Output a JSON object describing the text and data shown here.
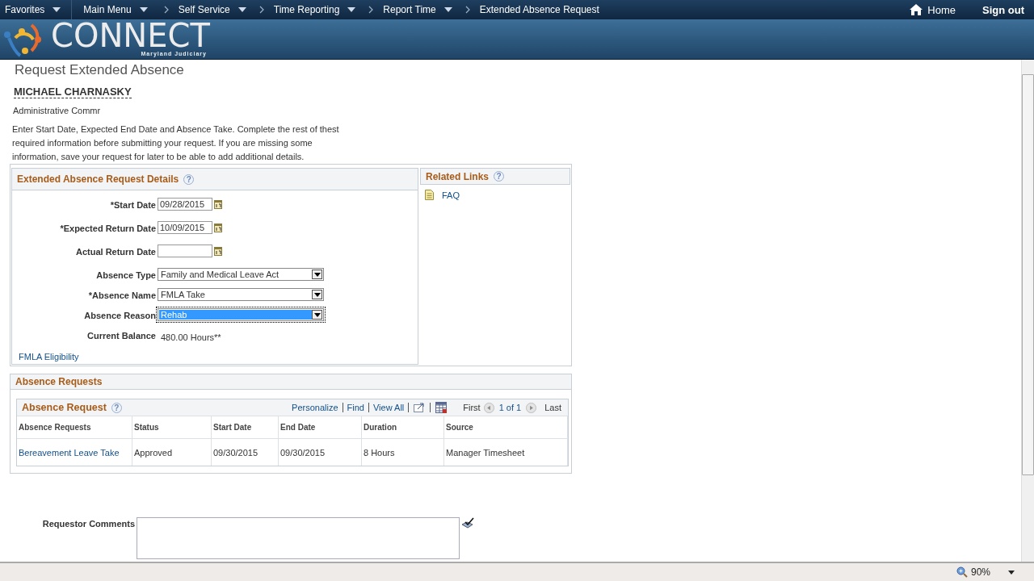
{
  "nav": {
    "items": [
      {
        "label": "Favorites",
        "dropdown": true
      },
      {
        "label": "Main Menu",
        "dropdown": true
      },
      {
        "label": "Self Service",
        "dropdown": true
      },
      {
        "label": "Time Reporting",
        "dropdown": true
      },
      {
        "label": "Report Time",
        "dropdown": true
      },
      {
        "label": "Extended Absence Request",
        "dropdown": false
      }
    ],
    "home": "Home",
    "sign_out": "Sign out"
  },
  "banner": {
    "logo": "CONNECT",
    "tagline": "Maryland Judiciary"
  },
  "page_title": "Request Extended Absence",
  "employee_name": "MICHAEL CHARNASKY",
  "job_title": "Administrative Commr",
  "instructions": "Enter Start Date, Expected End Date and Absence Take. Complete the rest of thest required information before submitting your request. If you are missing some information, save your request for later to be able to add additional details.",
  "details": {
    "title": "Extended Absence Request Details",
    "help": "?",
    "fields": [
      {
        "kind": "date",
        "label": "*Start Date",
        "value": "09/28/2015"
      },
      {
        "kind": "date",
        "label": "*Expected Return Date",
        "value": "10/09/2015"
      },
      {
        "kind": "date",
        "label": "Actual Return Date"
      },
      {
        "kind": "select",
        "label": "Absence Type",
        "value": "Family and Medical Leave Act",
        "focused": false
      },
      {
        "kind": "select",
        "label": "*Absence Name",
        "value": "FMLA Take",
        "focused": false
      },
      {
        "kind": "select",
        "label": "Absence Reason",
        "value": "Rehab",
        "focused": true
      },
      {
        "kind": "display",
        "label": "Current Balance",
        "value": "480.00 Hours**"
      }
    ],
    "link": "FMLA Eligibility"
  },
  "related_links": {
    "title": "Related Links",
    "help": "?",
    "links": [
      "FAQ"
    ]
  },
  "absence_requests": {
    "title": "Absence Requests",
    "grid_title": "Absence Request",
    "help": "?",
    "toolbar": [
      "Personalize",
      "Find",
      "View All"
    ],
    "pager": {
      "first": "First",
      "range": "1 of 1",
      "last": "Last"
    },
    "columns": [
      "Absence Requests",
      "Status",
      "Start Date",
      "End Date",
      "Duration",
      "Source"
    ],
    "rows": [
      [
        "Bereavement Leave Take",
        "Approved",
        "09/30/2015",
        "09/30/2015",
        "8 Hours",
        "Manager Timesheet"
      ]
    ]
  },
  "comments": {
    "label": "Requestor Comments"
  },
  "status_bar": {
    "zoom": "90%"
  }
}
